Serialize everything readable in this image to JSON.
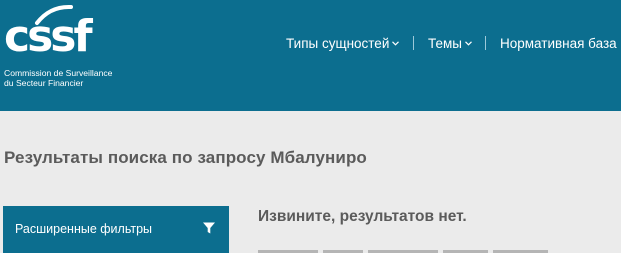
{
  "header": {
    "logo": {
      "wordmark": "cssf",
      "subtitle_line1": "Commission de Surveillance",
      "subtitle_line2": "du Secteur Financier"
    },
    "nav": [
      {
        "label": "Типы сущностей",
        "has_dropdown": true
      },
      {
        "label": "Темы",
        "has_dropdown": true
      },
      {
        "label": "Нормативная база",
        "has_dropdown": false
      }
    ]
  },
  "main": {
    "page_title": "Результаты поиска по запросу Мбалуниро",
    "filters_button_label": "Расширенные фильтры",
    "no_results_title": "Извините, результатов нет."
  },
  "colors": {
    "brand": "#0c6e8f",
    "background": "#ebebeb",
    "heading_text": "#5b5b5b"
  }
}
